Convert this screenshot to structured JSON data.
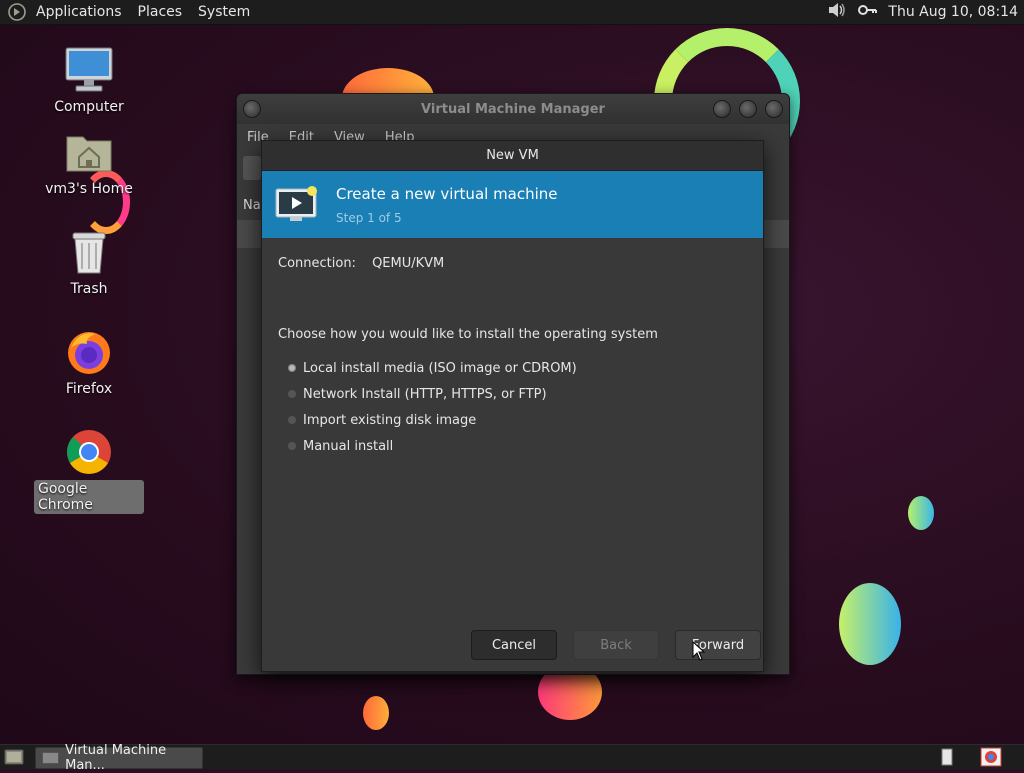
{
  "top_panel": {
    "menus": [
      "Applications",
      "Places",
      "System"
    ],
    "clock": "Thu Aug 10, 08:14",
    "icons": [
      "volume-icon",
      "network-key-icon"
    ]
  },
  "desktop": {
    "icons": [
      {
        "label": "Computer",
        "icon": "computer-icon",
        "selected": false
      },
      {
        "label": "vm3's Home",
        "icon": "home-folder-icon",
        "selected": false
      },
      {
        "label": "Trash",
        "icon": "trash-icon",
        "selected": false
      },
      {
        "label": "Firefox",
        "icon": "firefox-icon",
        "selected": false
      },
      {
        "label": "Google Chrome",
        "icon": "chrome-icon",
        "selected": true
      }
    ]
  },
  "vmm_window": {
    "title": "Virtual Machine Manager",
    "menu": [
      "File",
      "Edit",
      "View",
      "Help"
    ],
    "column_stub": "Na"
  },
  "dialog": {
    "title": "New VM",
    "banner_title": "Create a new virtual machine",
    "banner_step": "Step 1 of 5",
    "connection_label": "Connection:",
    "connection_value": "QEMU/KVM",
    "prompt": "Choose how you would like to install the operating system",
    "options": [
      {
        "label": "Local install media (ISO image or CDROM)",
        "selected": true
      },
      {
        "label": "Network Install (HTTP, HTTPS, or FTP)",
        "selected": false
      },
      {
        "label": "Import existing disk image",
        "selected": false
      },
      {
        "label": "Manual install",
        "selected": false
      }
    ],
    "buttons": {
      "cancel": "Cancel",
      "back": "Back",
      "forward": "Forward"
    },
    "back_enabled": false
  },
  "bottom_panel": {
    "task_label": "Virtual Machine Man..."
  },
  "colors": {
    "banner": "#1a7fb4",
    "panel": "#1d1d1d",
    "dialog_bg": "#393939"
  }
}
